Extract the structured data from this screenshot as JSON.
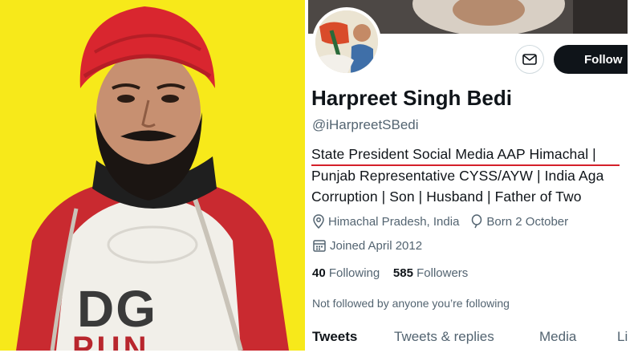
{
  "photo": {
    "shirt_logo_text": "DG",
    "shirt_sub_text": "PUN"
  },
  "profile": {
    "name": "Harpreet Singh Bedi",
    "handle": "@iHarpreetSBedi",
    "follow_label": "Follow",
    "bio_lines": [
      "State President Social Media AAP Himachal |",
      "Punjab Representative CYSS/AYW | India Aga",
      "Corruption | Son | Husband | Father of Two"
    ],
    "location": "Himachal Pradesh, India",
    "birthday": "Born 2 October",
    "joined": "Joined April 2012",
    "following_count": "40",
    "following_label": "Following",
    "followers_count": "585",
    "followers_label": "Followers",
    "not_followed": "Not followed by anyone you’re following",
    "tabs": [
      "Tweets",
      "Tweets & replies",
      "Media",
      "Li"
    ]
  },
  "colors": {
    "background_yellow": "#f7e91a",
    "turban_red": "#d9262f",
    "highlight_underline": "#d4202a",
    "follow_button": "#0f1419",
    "secondary_text": "#536471"
  },
  "icons": [
    "envelope-icon",
    "location-pin-icon",
    "balloon-icon",
    "calendar-icon"
  ]
}
